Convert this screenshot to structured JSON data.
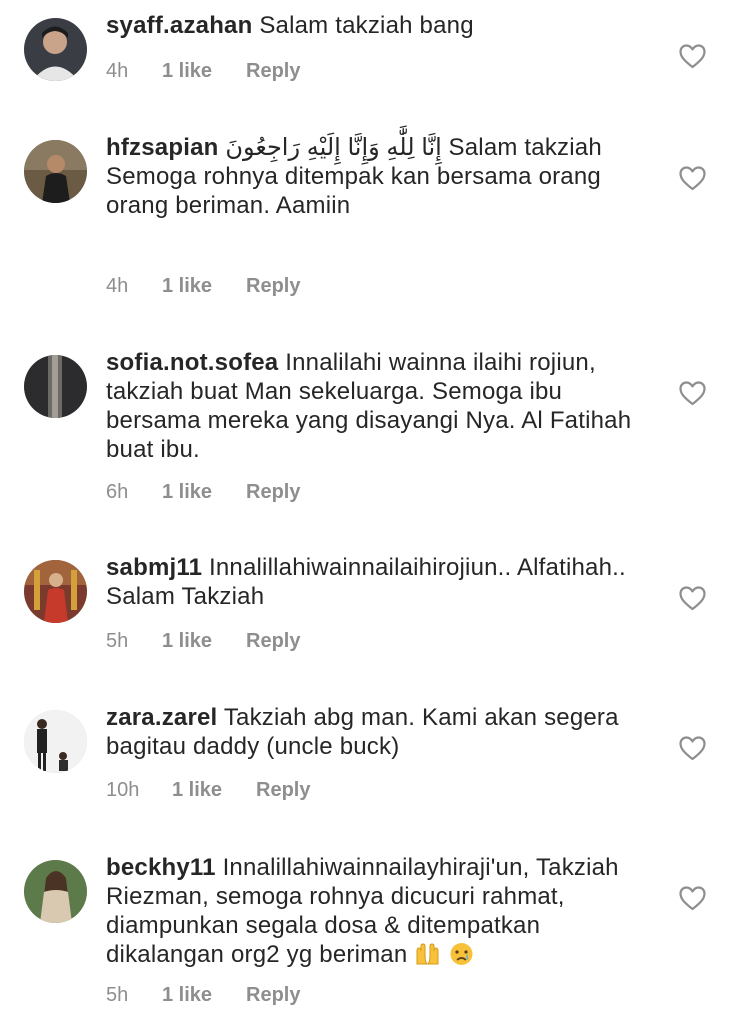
{
  "comments": [
    {
      "username": "syaff.azahan",
      "text": "Salam takziah bang",
      "time": "4h",
      "likes": "1 like",
      "reply": "Reply",
      "avatar_color": "#3a3d44"
    },
    {
      "username": "hfzsapian",
      "text": "إِنَّا لِلَّٰهِ وَإِنَّا إِلَيْهِ رَاجِعُونَ Salam takziah Semoga rohnya ditempak kan bersama orang orang beriman. Aamiin",
      "time": "4h",
      "likes": "1 like",
      "reply": "Reply",
      "avatar_color": "#6b5a44"
    },
    {
      "username": "sofia.not.sofea",
      "text": "Innalilahi wainna ilaihi rojiun, takziah buat Man sekeluarga. Semoga ibu bersama mereka yang disayangi Nya. Al Fatihah buat ibu.",
      "time": "6h",
      "likes": "1 like",
      "reply": "Reply",
      "avatar_color": "#2c2c2e"
    },
    {
      "username": "sabmj11",
      "text": "Innalillahiwainnailaihirojiun.. Alfatihah.. Salam Takziah",
      "time": "5h",
      "likes": "1 like",
      "reply": "Reply",
      "avatar_color": "#7a3b2e"
    },
    {
      "username": "zara.zarel",
      "text": "Takziah abg man. Kami akan segera bagitau daddy (uncle buck)",
      "time": "10h",
      "likes": "1 like",
      "reply": "Reply",
      "avatar_color": "#f2f2f2"
    },
    {
      "username": "beckhy11",
      "text": "Innalillahiwainnailayhiraji'un, Takziah Riezman, semoga rohnya dicucuri rahmat, diampunkan segala dosa & ditempatkan dikalangan org2 yg beriman",
      "time": "5h",
      "likes": "1 like",
      "reply": "Reply",
      "avatar_color": "#5d7a4a",
      "emojis": [
        "raised-hands-icon",
        "crying-face-icon"
      ]
    }
  ],
  "colors": {
    "text": "#262626",
    "meta": "#8e8e8e",
    "heart_outline": "#8e8e8e",
    "emoji_yellow": "#f7c23a"
  }
}
